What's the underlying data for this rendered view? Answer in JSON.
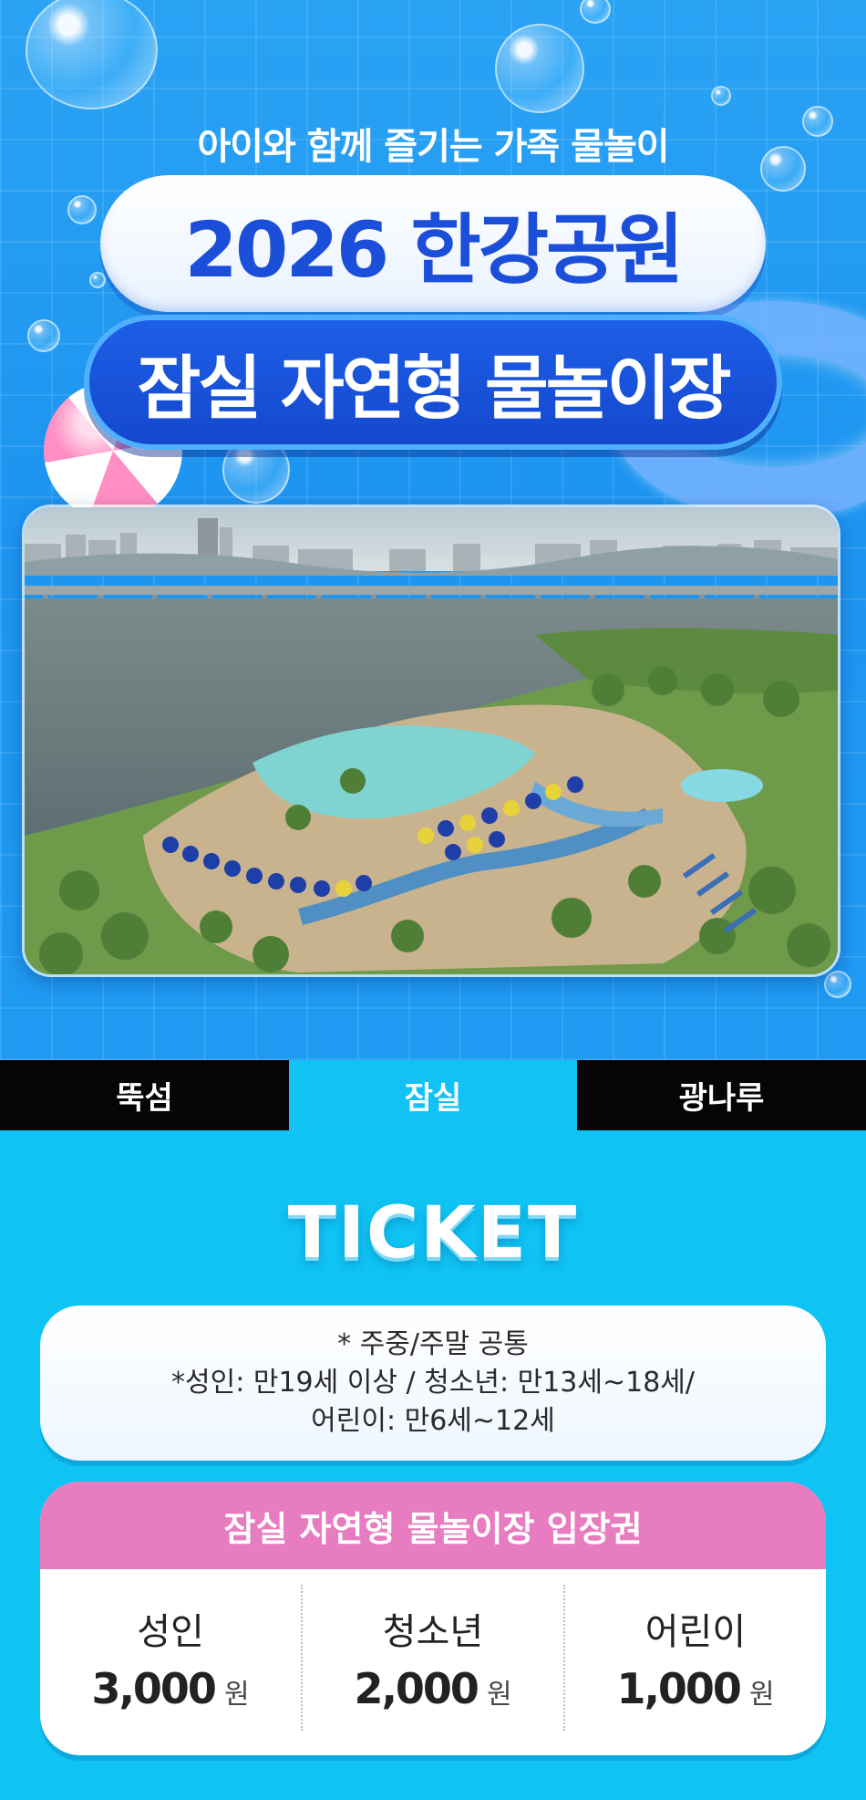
{
  "hero": {
    "subtitle": "아이와 함께 즐기는 가족 물놀이",
    "title_line1": "2026 한강공원",
    "title_line2": "잠실 자연형 물놀이장"
  },
  "tabs": [
    {
      "label": "뚝섬",
      "active": false
    },
    {
      "label": "잠실",
      "active": true
    },
    {
      "label": "광나루",
      "active": false
    }
  ],
  "ticket": {
    "heading": "TICKET",
    "notice": [
      "* 주중/주말 공통",
      "*성인: 만19세 이상 / 청소년: 만13세~18세/",
      "어린이: 만6세~12세"
    ],
    "card_title": "잠실 자연형 물놀이장 입장권",
    "prices": [
      {
        "category": "성인",
        "amount": "3,000",
        "unit": "원"
      },
      {
        "category": "청소년",
        "amount": "2,000",
        "unit": "원"
      },
      {
        "category": "어린이",
        "amount": "1,000",
        "unit": "원"
      }
    ]
  },
  "colors": {
    "hero_bg": "#1e95f0",
    "title_blue": "#1b4fd9",
    "tab_active": "#12c2f5",
    "tab_inactive": "#050505",
    "section_bg": "#0fc3f3",
    "card_header_pink": "#e87cc0"
  }
}
